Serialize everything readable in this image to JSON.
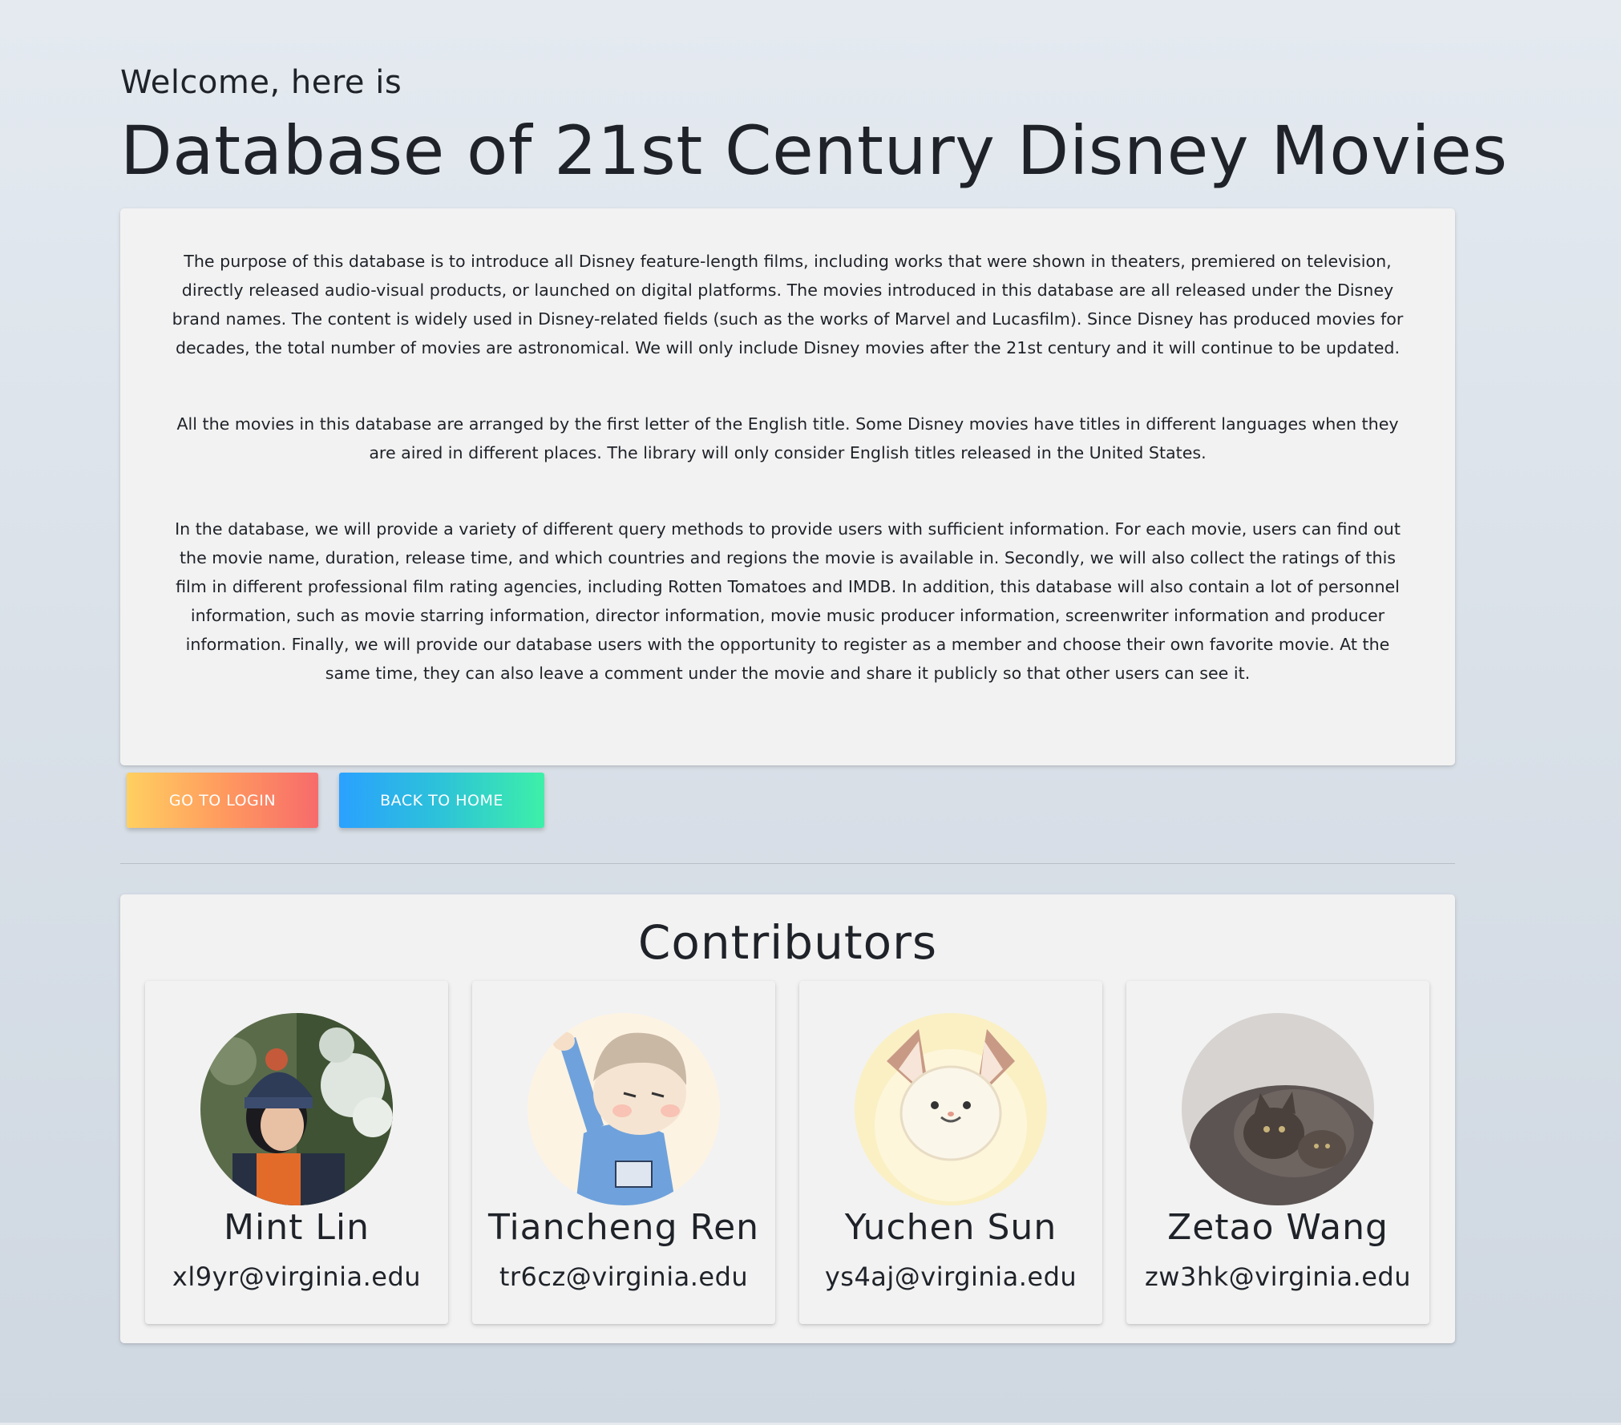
{
  "header": {
    "welcome": "Welcome, here is",
    "title": "Database of 21st Century Disney Movies"
  },
  "intro": {
    "paragraphs": [
      "The purpose of this database is to introduce all Disney feature-length films, including works that were shown in theaters, premiered on television, directly released audio-visual products, or launched on digital platforms. The movies introduced in this database are all released under the Disney brand names. The content is widely used in Disney-related fields (such as the works of Marvel and Lucasfilm). Since Disney has produced movies for decades, the total number of movies are astronomical. We will only include Disney movies after the 21st century and it will continue to be updated.",
      "All the movies in this database are arranged by the first letter of the English title. Some Disney movies have titles in different languages when they are aired in different places. The library will only consider English titles released in the United States.",
      "In the database, we will provide a variety of different query methods to provide users with sufficient information. For each movie, users can find out the movie name, duration, release time, and which countries and regions the movie is available in. Secondly, we will also collect the ratings of this film in different professional film rating agencies, including Rotten Tomatoes and IMDB. In addition, this database will also contain a lot of personnel information, such as movie starring information, director information, movie music producer information, screenwriter information and producer information. Finally, we will provide our database users with the opportunity to register as a member and choose their own favorite movie. At the same time, they can also leave a comment under the movie and share it publicly so that other users can see it."
    ]
  },
  "buttons": {
    "login_label": "GO TO LOGIN",
    "home_label": "BACK TO HOME"
  },
  "contributors": {
    "title": "Contributors",
    "people": [
      {
        "name": "Mint Lin",
        "email": "xl9yr@virginia.edu",
        "avatar": "photo-avatar"
      },
      {
        "name": "Tiancheng Ren",
        "email": "tr6cz@virginia.edu",
        "avatar": "cartoon-boy-avatar"
      },
      {
        "name": "Yuchen Sun",
        "email": "ys4aj@virginia.edu",
        "avatar": "cartoon-cat-avatar"
      },
      {
        "name": "Zetao Wang",
        "email": "zw3hk@virginia.edu",
        "avatar": "kitten-photo-avatar"
      }
    ]
  },
  "colors": {
    "login_gradient": [
      "#ffd060",
      "#f76b6b"
    ],
    "home_gradient": [
      "#2aa1ff",
      "#3df0a8"
    ],
    "card_bg": "#f2f2f2"
  }
}
